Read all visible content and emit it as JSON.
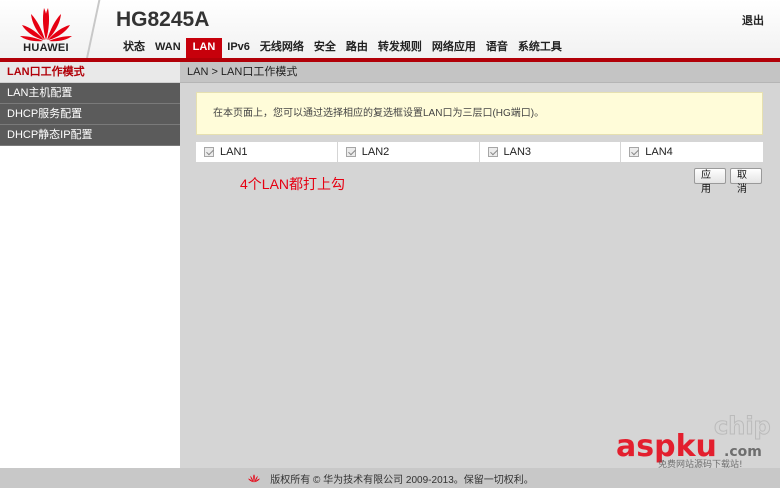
{
  "header": {
    "brand": "HUAWEI",
    "model": "HG8245A",
    "logout_label": "退出"
  },
  "nav": {
    "items": [
      {
        "label": "状态",
        "active": false
      },
      {
        "label": "WAN",
        "active": false
      },
      {
        "label": "LAN",
        "active": true
      },
      {
        "label": "IPv6",
        "active": false
      },
      {
        "label": "无线网络",
        "active": false
      },
      {
        "label": "安全",
        "active": false
      },
      {
        "label": "路由",
        "active": false
      },
      {
        "label": "转发规则",
        "active": false
      },
      {
        "label": "网络应用",
        "active": false
      },
      {
        "label": "语音",
        "active": false
      },
      {
        "label": "系统工具",
        "active": false
      }
    ]
  },
  "sidebar": {
    "items": [
      {
        "label": "LAN口工作模式",
        "active": true
      },
      {
        "label": "LAN主机配置",
        "active": false
      },
      {
        "label": "DHCP服务配置",
        "active": false
      },
      {
        "label": "DHCP静态IP配置",
        "active": false
      }
    ]
  },
  "main": {
    "breadcrumb": "LAN > LAN口工作模式",
    "info_text": "在本页面上，您可以通过选择相应的复选框设置LAN口为三层口(HG端口)。",
    "lan_ports": [
      {
        "label": "LAN1",
        "checked": true
      },
      {
        "label": "LAN2",
        "checked": true
      },
      {
        "label": "LAN3",
        "checked": true
      },
      {
        "label": "LAN4",
        "checked": true
      }
    ],
    "annotation": "4个LAN都打上勾",
    "apply_label": "应用",
    "cancel_label": "取消"
  },
  "footer": {
    "copyright": "版权所有 © 华为技术有限公司 2009-2013。保留一切权利。"
  },
  "watermark": {
    "text_main": "aspku",
    "text_sub": ".com",
    "text_chip": "chip",
    "tagline": "免费网站源码下载站!"
  },
  "colors": {
    "accent_red": "#c7000b",
    "sidebar_dark": "#5b5b5b",
    "content_bg": "#d5d5d5",
    "info_bg": "#fffcd9",
    "annotation_red": "#e60012"
  }
}
